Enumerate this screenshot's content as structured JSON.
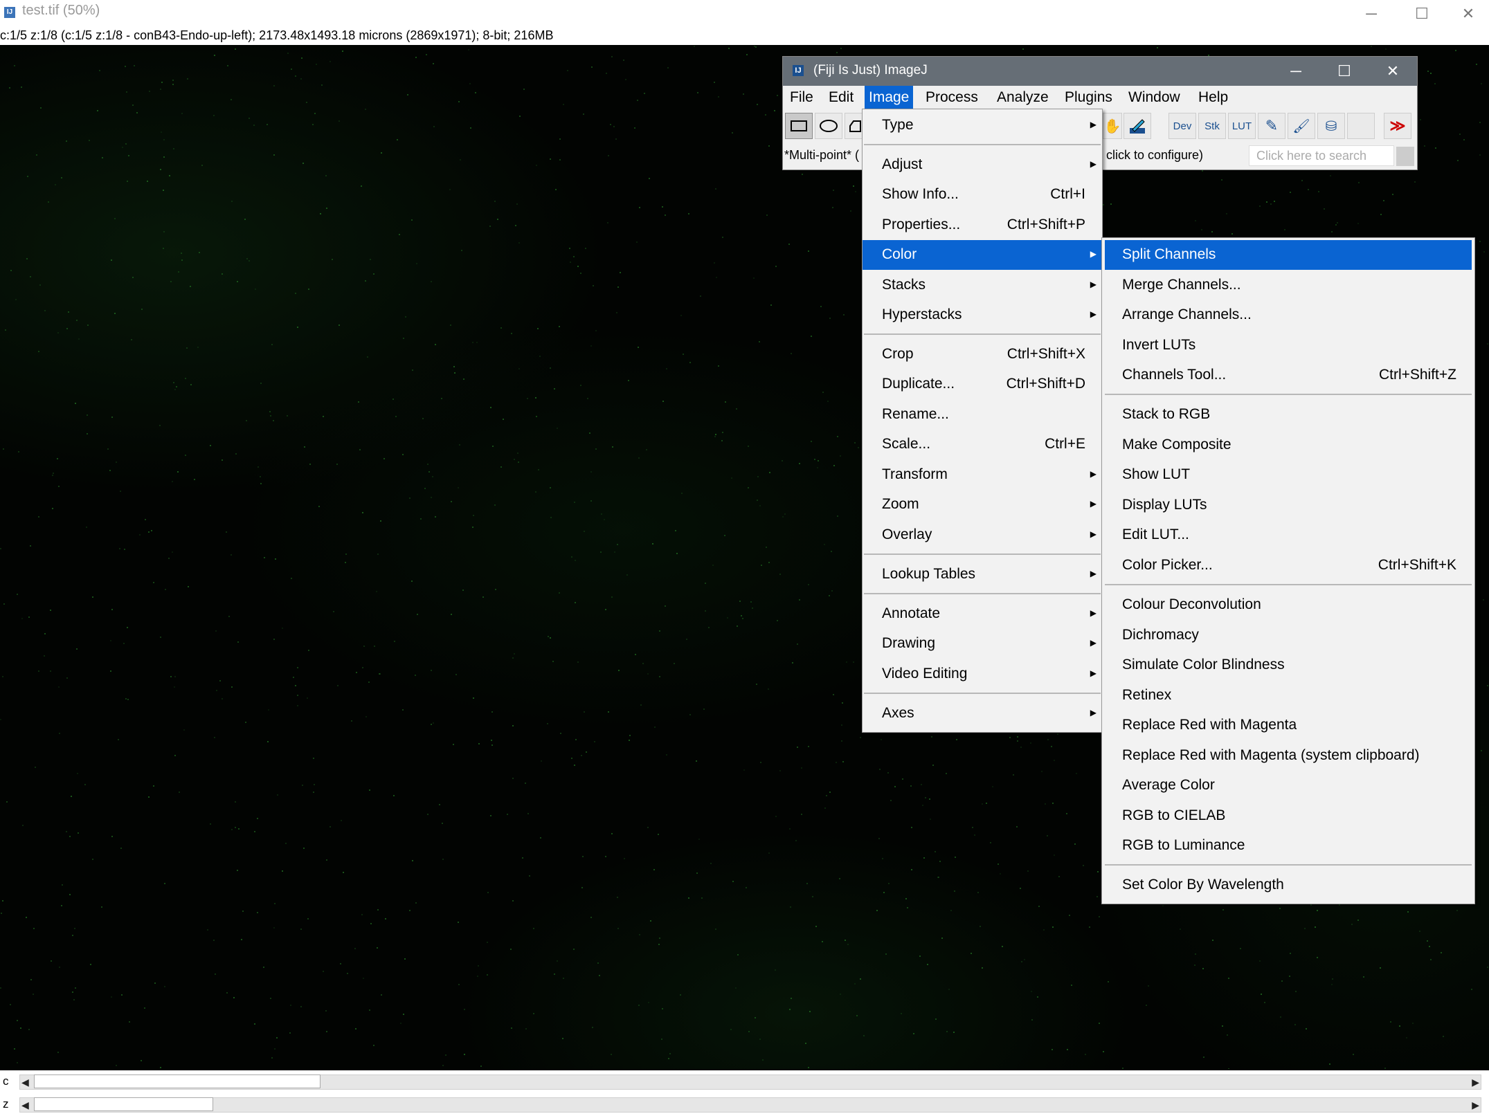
{
  "image_window": {
    "title": "test.tif (50%)",
    "info": "c:1/5 z:1/8 (c:1/5 z:1/8 - conB43-Endo-up-left); 2173.48x1493.18 microns (2869x1971); 8-bit; 216MB",
    "icon": "imagej-icon",
    "controls": {
      "minimize": "─",
      "maximize": "☐",
      "close": "✕"
    },
    "sliders": [
      {
        "label": "c",
        "left_arrow": "◀",
        "right_arrow": "▶",
        "fraction": 0.2
      },
      {
        "label": "z",
        "left_arrow": "◀",
        "right_arrow": "▶",
        "fraction": 0.125
      }
    ]
  },
  "fiji_window": {
    "title": "(Fiji Is Just) ImageJ",
    "controls": {
      "minimize": "─",
      "maximize": "☐",
      "close": "✕"
    },
    "menubar": [
      "File",
      "Edit",
      "Image",
      "Process",
      "Analyze",
      "Plugins",
      "Window",
      "Help"
    ],
    "active_menu": "Image",
    "toolbar": {
      "left_tools": [
        "rectangle-tool-icon",
        "oval-tool-icon",
        "polygon-tool-icon"
      ],
      "hand_glyph": "✋",
      "right_tools": [
        {
          "name": "dev-tool",
          "text": "Dev"
        },
        {
          "name": "stk-tool",
          "text": "Stk"
        },
        {
          "name": "lut-tool",
          "text": "LUT"
        },
        {
          "name": "pencil-tool",
          "text": "✎"
        },
        {
          "name": "brush-tool",
          "text": "🖌"
        },
        {
          "name": "flood-fill-tool",
          "text": "⛁"
        }
      ],
      "more_glyph": "≫"
    },
    "status_left": "*Multi-point* (",
    "status_right": "click to configure)",
    "search_placeholder": "Click here to search"
  },
  "image_menu": {
    "items": [
      {
        "label": "Type",
        "submenu": true
      },
      {
        "sep": true
      },
      {
        "label": "Adjust",
        "submenu": true
      },
      {
        "label": "Show Info...",
        "shortcut": "Ctrl+I"
      },
      {
        "label": "Properties...",
        "shortcut": "Ctrl+Shift+P"
      },
      {
        "label": "Color",
        "submenu": true,
        "highlighted": true
      },
      {
        "label": "Stacks",
        "submenu": true
      },
      {
        "label": "Hyperstacks",
        "submenu": true
      },
      {
        "sep": true
      },
      {
        "label": "Crop",
        "shortcut": "Ctrl+Shift+X"
      },
      {
        "label": "Duplicate...",
        "shortcut": "Ctrl+Shift+D"
      },
      {
        "label": "Rename..."
      },
      {
        "label": "Scale...",
        "shortcut": "Ctrl+E"
      },
      {
        "label": "Transform",
        "submenu": true
      },
      {
        "label": "Zoom",
        "submenu": true
      },
      {
        "label": "Overlay",
        "submenu": true
      },
      {
        "sep": true
      },
      {
        "label": "Lookup Tables",
        "submenu": true
      },
      {
        "sep": true
      },
      {
        "label": "Annotate",
        "submenu": true
      },
      {
        "label": "Drawing",
        "submenu": true
      },
      {
        "label": "Video Editing",
        "submenu": true
      },
      {
        "sep": true
      },
      {
        "label": "Axes",
        "submenu": true
      }
    ],
    "submenu_arrow": "▶"
  },
  "color_menu": {
    "items": [
      {
        "label": "Split Channels",
        "highlighted": true
      },
      {
        "label": "Merge Channels..."
      },
      {
        "label": "Arrange Channels..."
      },
      {
        "label": "Invert LUTs"
      },
      {
        "label": "Channels Tool...",
        "shortcut": "Ctrl+Shift+Z"
      },
      {
        "sep": true
      },
      {
        "label": "Stack to RGB"
      },
      {
        "label": "Make Composite"
      },
      {
        "label": "Show LUT"
      },
      {
        "label": "Display LUTs"
      },
      {
        "label": "Edit LUT..."
      },
      {
        "label": "Color Picker...",
        "shortcut": "Ctrl+Shift+K"
      },
      {
        "sep": true
      },
      {
        "label": "Colour Deconvolution"
      },
      {
        "label": "Dichromacy"
      },
      {
        "label": "Simulate Color Blindness"
      },
      {
        "label": "Retinex"
      },
      {
        "label": "Replace Red with Magenta"
      },
      {
        "label": "Replace Red with Magenta (system clipboard)"
      },
      {
        "label": "Average Color"
      },
      {
        "label": "RGB to CIELAB"
      },
      {
        "label": "RGB to Luminance"
      },
      {
        "sep": true
      },
      {
        "label": "Set Color By Wavelength"
      }
    ]
  },
  "colors": {
    "highlight": "#0a64d2",
    "menu_bg": "#f2f2f2",
    "fiji_titlebar": "#666e76",
    "canvas": "#020402",
    "speckle": "#2a8a2a"
  }
}
